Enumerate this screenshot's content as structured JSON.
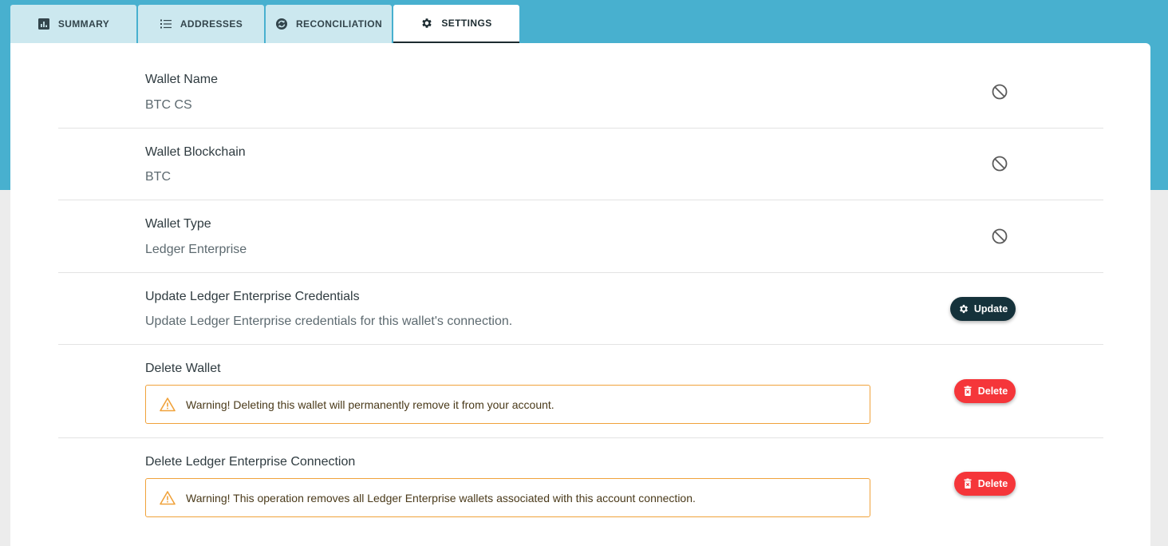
{
  "tabs": [
    {
      "label": "SUMMARY",
      "icon": "bar-chart-icon"
    },
    {
      "label": "ADDRESSES",
      "icon": "list-icon"
    },
    {
      "label": "RECONCILIATION",
      "icon": "reconcile-icon"
    },
    {
      "label": "SETTINGS",
      "icon": "gear-icon",
      "active": true
    }
  ],
  "settings": {
    "wallet_name": {
      "title": "Wallet Name",
      "value": "BTC CS",
      "icon": "block-icon"
    },
    "wallet_blockchain": {
      "title": "Wallet Blockchain",
      "value": "BTC",
      "icon": "block-icon"
    },
    "wallet_type": {
      "title": "Wallet Type",
      "value": "Ledger Enterprise",
      "icon": "block-icon"
    },
    "update_credentials": {
      "title": "Update Ledger Enterprise Credentials",
      "description": "Update Ledger Enterprise credentials for this wallet's connection.",
      "button_label": "Update"
    },
    "delete_wallet": {
      "title": "Delete Wallet",
      "warning": "Warning! Deleting this wallet will permanently remove it from your account.",
      "button_label": "Delete"
    },
    "delete_connection": {
      "title": "Delete Ledger Enterprise Connection",
      "warning": "Warning! This operation removes all Ledger Enterprise wallets associated with this account connection.",
      "button_label": "Delete"
    }
  },
  "colors": {
    "header_band": "#48b0cf",
    "tab_inactive": "#cce8ef",
    "update_button": "#15323b",
    "delete_button": "#f5363a",
    "warning_border": "#f0a23b"
  }
}
